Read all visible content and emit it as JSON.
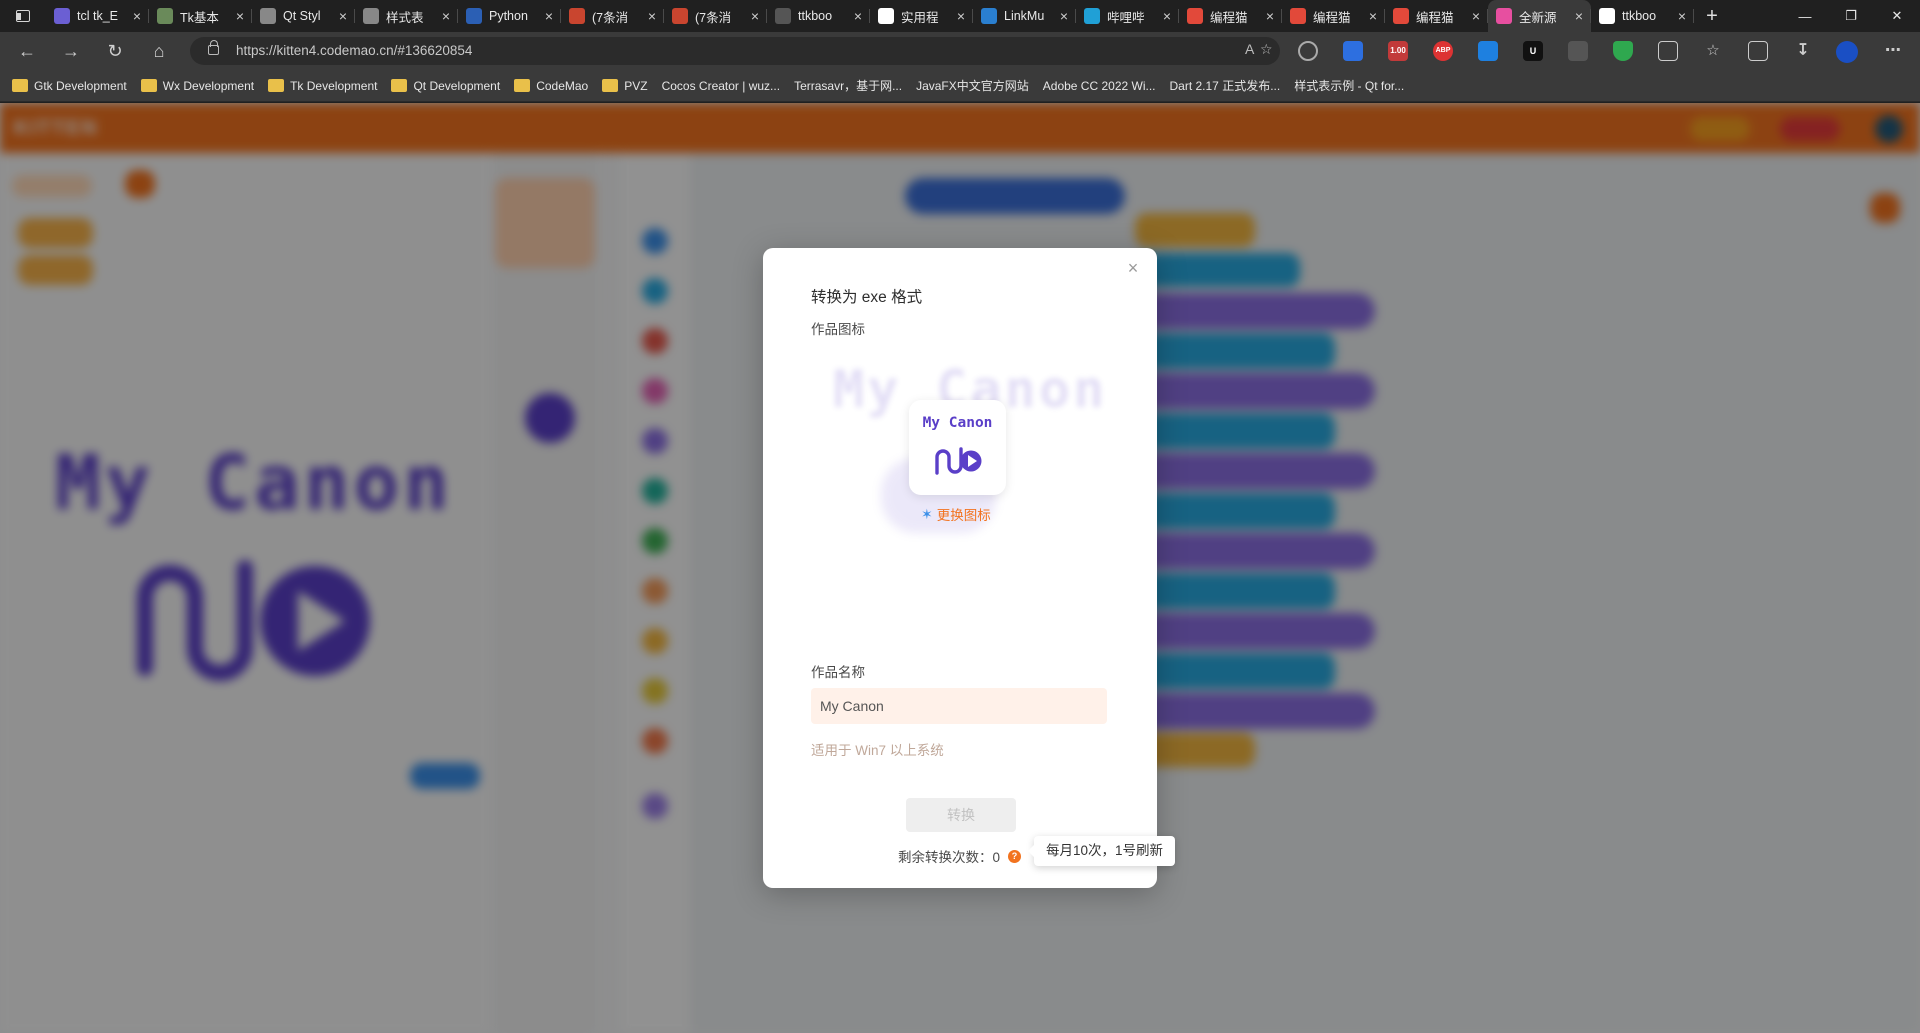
{
  "browser": {
    "tabs": [
      {
        "label": "tcl tk_E",
        "favicon_color": "#6b5fd3"
      },
      {
        "label": "Tk基本",
        "favicon_color": "#6a8a5a"
      },
      {
        "label": "Qt Styl",
        "favicon_color": "#888888"
      },
      {
        "label": "样式表",
        "favicon_color": "#888888"
      },
      {
        "label": "Python",
        "favicon_color": "#2b5fb4"
      },
      {
        "label": "(7条消",
        "favicon_color": "#c9452f"
      },
      {
        "label": "(7条消",
        "favicon_color": "#c9452f"
      },
      {
        "label": "ttkboo",
        "favicon_color": "#555555"
      },
      {
        "label": "实用程",
        "favicon_color": "#ffffff"
      },
      {
        "label": "LinkMu",
        "favicon_color": "#2a7fd0"
      },
      {
        "label": "哔哩哔",
        "favicon_color": "#20a0d6"
      },
      {
        "label": "编程猫",
        "favicon_color": "#e2493a"
      },
      {
        "label": "编程猫",
        "favicon_color": "#e2493a"
      },
      {
        "label": "编程猫",
        "favicon_color": "#e2493a"
      },
      {
        "label": "全新源",
        "favicon_color": "#e74fa0"
      },
      {
        "label": "ttkboo",
        "favicon_color": "#ffffff"
      }
    ],
    "active_tab_index": 14,
    "url": "https://kitten4.codemao.cn/#136620854",
    "url_host": "kitten4.codemao.cn",
    "extension_badge": "1.00",
    "bookmarks": [
      {
        "label": "Gtk Development",
        "kind": "folder"
      },
      {
        "label": "Wx Development",
        "kind": "folder"
      },
      {
        "label": "Tk Development",
        "kind": "folder"
      },
      {
        "label": "Qt Development",
        "kind": "folder"
      },
      {
        "label": "CodeMao",
        "kind": "folder"
      },
      {
        "label": "PVZ",
        "kind": "folder"
      },
      {
        "label": "Cocos Creator | wuz...",
        "kind": "page"
      },
      {
        "label": "Terrasavr，基于网...",
        "kind": "page"
      },
      {
        "label": "JavaFX中文官方网站",
        "kind": "page"
      },
      {
        "label": "Adobe CC 2022 Wi...",
        "kind": "page"
      },
      {
        "label": "Dart 2.17 正式发布...",
        "kind": "page"
      },
      {
        "label": "样式表示例 - Qt for...",
        "kind": "page"
      }
    ]
  },
  "background_app": {
    "stage_text": "My Canon",
    "brand": "KITTEN"
  },
  "modal": {
    "title": "转换为 exe 格式",
    "icon_label": "作品图标",
    "icon_preview_text": "My Canon",
    "change_icon_label": "更换图标",
    "name_label": "作品名称",
    "name_value": "My Canon",
    "hint": "适用于 Win7 以上系统",
    "convert_button": "转换",
    "remaining_label": "剩余转换次数：0",
    "tooltip": "每月10次，1号刷新",
    "close_symbol": "×"
  },
  "colors": {
    "accent_orange": "#f2731f",
    "brand_purple": "#5a3fc8",
    "input_bg": "#fff1e9"
  }
}
